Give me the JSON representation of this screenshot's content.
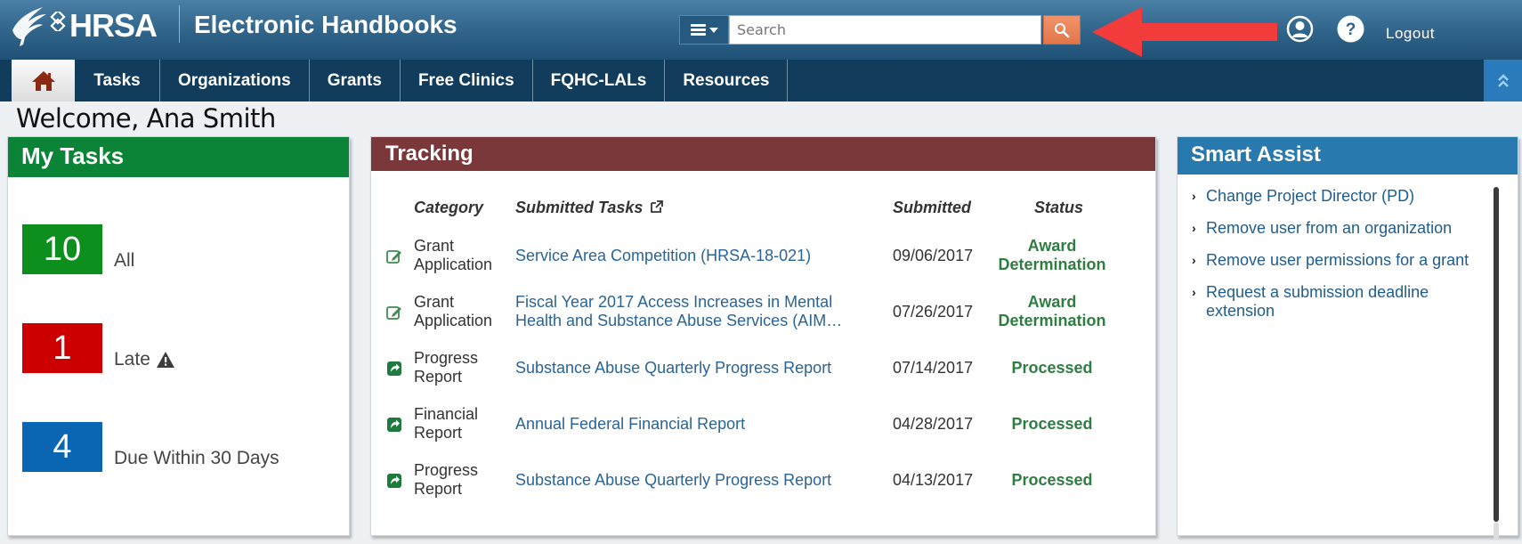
{
  "header": {
    "logo_text": "HRSA",
    "app_title": "Electronic Handbooks",
    "search": {
      "placeholder": "Search",
      "value": ""
    },
    "logout_label": "Logout",
    "icons": [
      "menu-icon",
      "search-icon",
      "user-account-icon",
      "help-icon"
    ]
  },
  "nav": {
    "items": [
      {
        "label": "Tasks"
      },
      {
        "label": "Organizations"
      },
      {
        "label": "Grants"
      },
      {
        "label": "Free Clinics"
      },
      {
        "label": "FQHC-LALs"
      },
      {
        "label": "Resources"
      }
    ]
  },
  "welcome": "Welcome, Ana Smith",
  "my_tasks": {
    "title": "My Tasks",
    "rows": [
      {
        "count": "10",
        "label": "All",
        "color": "#0d8f1e"
      },
      {
        "count": "1",
        "label": "Late",
        "color": "#cc0000",
        "warning": true
      },
      {
        "count": "4",
        "label": "Due Within 30 Days",
        "color": "#0a66b3"
      }
    ]
  },
  "tracking": {
    "title": "Tracking",
    "columns": [
      "Category",
      "Submitted Tasks",
      "Submitted",
      "Status"
    ],
    "rows": [
      {
        "icon": "edit-icon",
        "cat1": "Grant",
        "cat2": "Application",
        "task": "Service Area Competition (HRSA-18-021)",
        "task2": "",
        "date": "09/06/2017",
        "status1": "Award",
        "status2": "Determination"
      },
      {
        "icon": "edit-icon",
        "cat1": "Grant",
        "cat2": "Application",
        "task": "Fiscal Year 2017 Access Increases in Mental",
        "task2": "Health and Substance Abuse Services (AIM…",
        "date": "07/26/2017",
        "status1": "Award",
        "status2": "Determination"
      },
      {
        "icon": "share-icon",
        "cat1": "Progress",
        "cat2": "Report",
        "task": "Substance Abuse Quarterly Progress Report",
        "task2": "",
        "date": "07/14/2017",
        "status1": "Processed",
        "status2": ""
      },
      {
        "icon": "share-icon",
        "cat1": "Financial",
        "cat2": "Report",
        "task": "Annual Federal Financial Report",
        "task2": "",
        "date": "04/28/2017",
        "status1": "Processed",
        "status2": ""
      },
      {
        "icon": "share-icon",
        "cat1": "Progress",
        "cat2": "Report",
        "task": "Substance Abuse Quarterly Progress Report",
        "task2": "",
        "date": "04/13/2017",
        "status1": "Processed",
        "status2": ""
      }
    ]
  },
  "smart_assist": {
    "title": "Smart Assist",
    "items": [
      {
        "label": "Change Project Director (PD)"
      },
      {
        "label": "Remove user from an organization"
      },
      {
        "label": "Remove user permissions for a grant"
      },
      {
        "label": "Request a submission deadline extension"
      }
    ]
  },
  "colors": {
    "header": "#2f6389",
    "nav": "#123c5b",
    "my_tasks": "#0c8438",
    "tracking": "#7b383b",
    "smart_assist": "#2779ae",
    "search_button": "#e8804f",
    "status_green": "#2e7d41",
    "link": "#2a6496"
  }
}
